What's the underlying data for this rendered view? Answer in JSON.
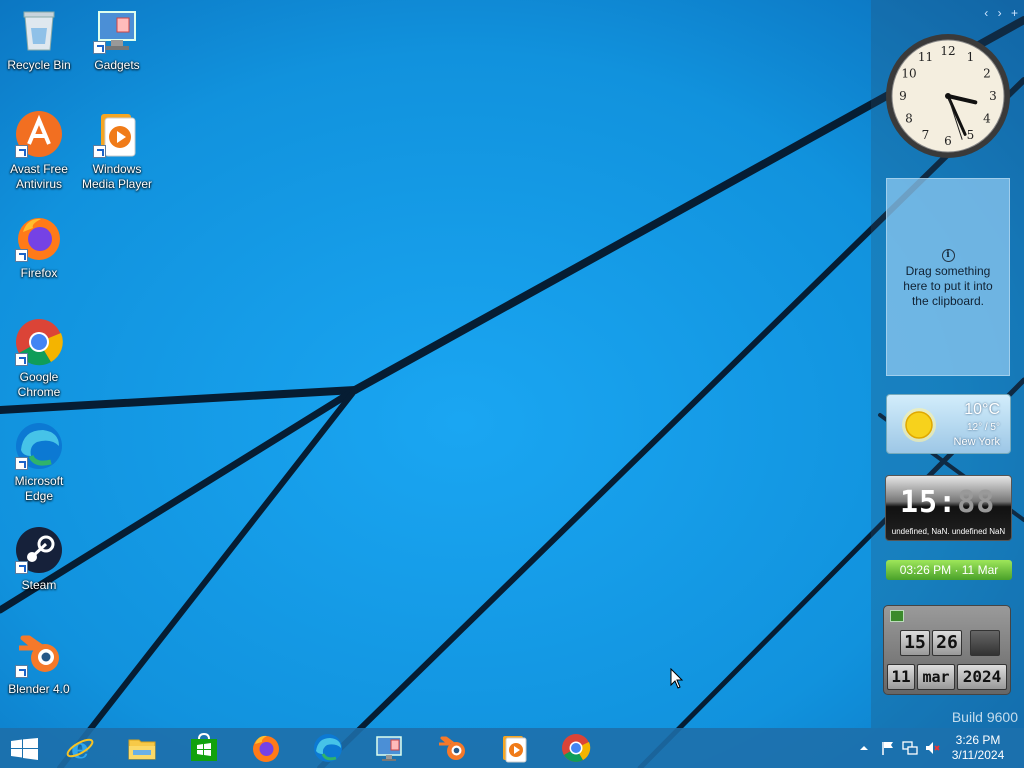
{
  "desktop": {
    "icons": [
      {
        "label": "Recycle Bin",
        "icon": "recycle-bin-icon"
      },
      {
        "label": "Gadgets",
        "icon": "gadgets-icon"
      },
      {
        "label": "Avast Free Antivirus",
        "icon": "avast-icon"
      },
      {
        "label": "Windows Media Player",
        "icon": "windows-media-player-icon"
      },
      {
        "label": "Firefox",
        "icon": "firefox-icon"
      },
      {
        "label": "Google Chrome",
        "icon": "chrome-icon"
      },
      {
        "label": "Microsoft Edge",
        "icon": "edge-icon"
      },
      {
        "label": "Steam",
        "icon": "steam-icon"
      },
      {
        "label": "Blender 4.0",
        "icon": "blender-icon"
      }
    ]
  },
  "sidebar": {
    "controls": [
      "‹",
      "›",
      "+"
    ],
    "analog_clock": {
      "hour": 3,
      "minute": 26,
      "second": 27
    },
    "clipboard": {
      "info": "i",
      "text": "Drag something here to put it into the clipboard."
    },
    "weather": {
      "temp": "10°C",
      "range": "12° / 5°",
      "city": "New York"
    },
    "digital_clock": {
      "time": "15:",
      "ghost": "88",
      "date": "undefined, NaN. undefined NaN"
    },
    "green_bar": {
      "text": "03:26 PM · 11 Mar"
    },
    "flip_clock": {
      "hour": "15",
      "minute": "26",
      "day": "11",
      "month": "mar",
      "year": "2024"
    }
  },
  "watermark": {
    "build": "Build 9600"
  },
  "taskbar": {
    "apps": [
      {
        "name": "Start",
        "icon": "windows-logo-icon"
      },
      {
        "name": "Internet Explorer",
        "icon": "internet-explorer-icon"
      },
      {
        "name": "File Explorer",
        "icon": "file-explorer-icon"
      },
      {
        "name": "Store",
        "icon": "store-icon"
      },
      {
        "name": "Firefox",
        "icon": "firefox-icon"
      },
      {
        "name": "Microsoft Edge",
        "icon": "edge-icon"
      },
      {
        "name": "Gadgets",
        "icon": "gadgets-icon"
      },
      {
        "name": "Blender",
        "icon": "blender-icon"
      },
      {
        "name": "Windows Media Player",
        "icon": "windows-media-player-icon"
      },
      {
        "name": "Google Chrome",
        "icon": "chrome-icon"
      }
    ],
    "tray": {
      "time": "3:26 PM",
      "date": "3/11/2024"
    }
  }
}
